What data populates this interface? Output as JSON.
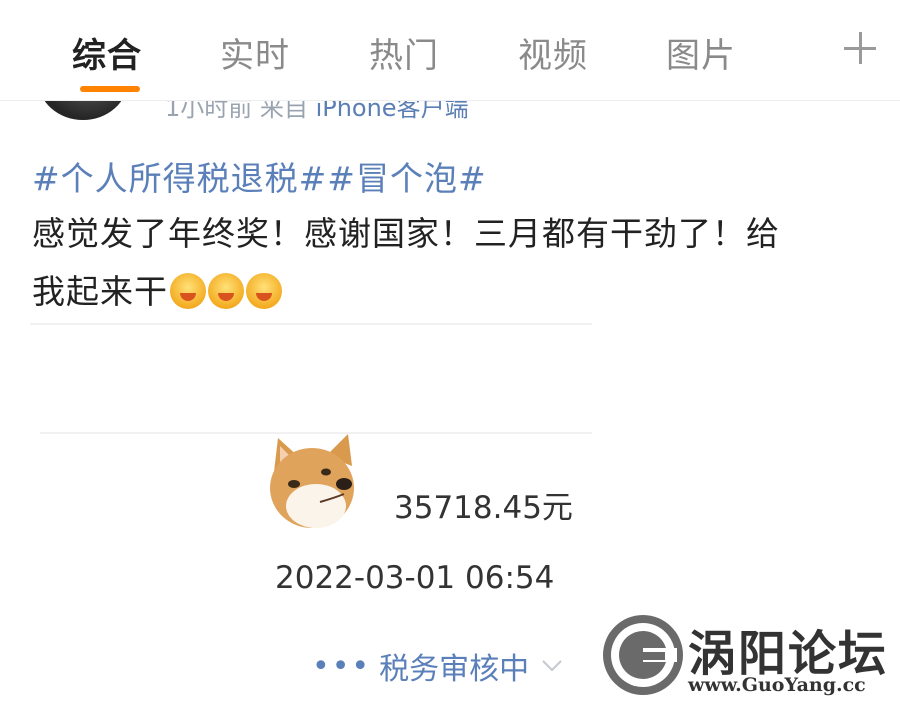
{
  "tabs": [
    {
      "label": "综合",
      "active": true
    },
    {
      "label": "实时",
      "active": false
    },
    {
      "label": "热门",
      "active": false
    },
    {
      "label": "视频",
      "active": false
    },
    {
      "label": "图片",
      "active": false
    }
  ],
  "accent_color": "#ff8200",
  "link_color": "#5b80b9",
  "post": {
    "meta_time": "1小时前",
    "meta_from": "来自",
    "meta_client": "iPhone客户端",
    "hashtags": "#个人所得税退税##冒个泡#",
    "text_line1": "感觉发了年终奖！感谢国家！三月都有干劲了！给",
    "text_line2": "我起来干",
    "emoji_name": "hug-emoji"
  },
  "screenshot_card": {
    "amount": "35718.45元",
    "datetime": "2022-03-01 06:54",
    "status": "税务审核中",
    "status_dots": "•••"
  },
  "watermark": {
    "title": "涡阳论坛",
    "url": "www.GuoYang.cc"
  }
}
